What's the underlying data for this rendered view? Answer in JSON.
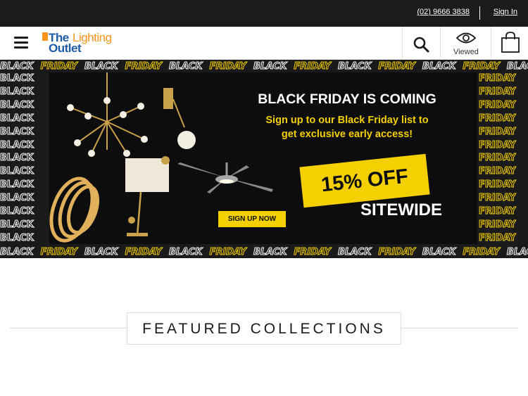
{
  "topbar": {
    "phone": "(02) 9666 3838",
    "sign_in": "Sign In"
  },
  "header": {
    "logo": {
      "line1": "The",
      "line2": "Lighting",
      "line3": "Outlet"
    },
    "search_icon": "search-icon",
    "viewed_label": "Viewed",
    "cart_icon": "shopping-bag-icon"
  },
  "banner": {
    "pattern_word_1": "BLACK",
    "pattern_word_2": "FRIDAY",
    "headline": "BLACK FRIDAY IS COMING",
    "subline_1": "Sign up to our Black Friday list to",
    "subline_2": "get exclusive early access!",
    "promo": "15% OFF",
    "sitewide": "SITEWIDE",
    "cta": "SIGN UP NOW"
  },
  "featured": {
    "title": "FEATURED COLLECTIONS"
  },
  "colors": {
    "topbar_bg": "#1b1b1b",
    "brand_blue": "#1d5aa8",
    "brand_orange": "#f7941d",
    "promo_yellow": "#f5d000"
  }
}
